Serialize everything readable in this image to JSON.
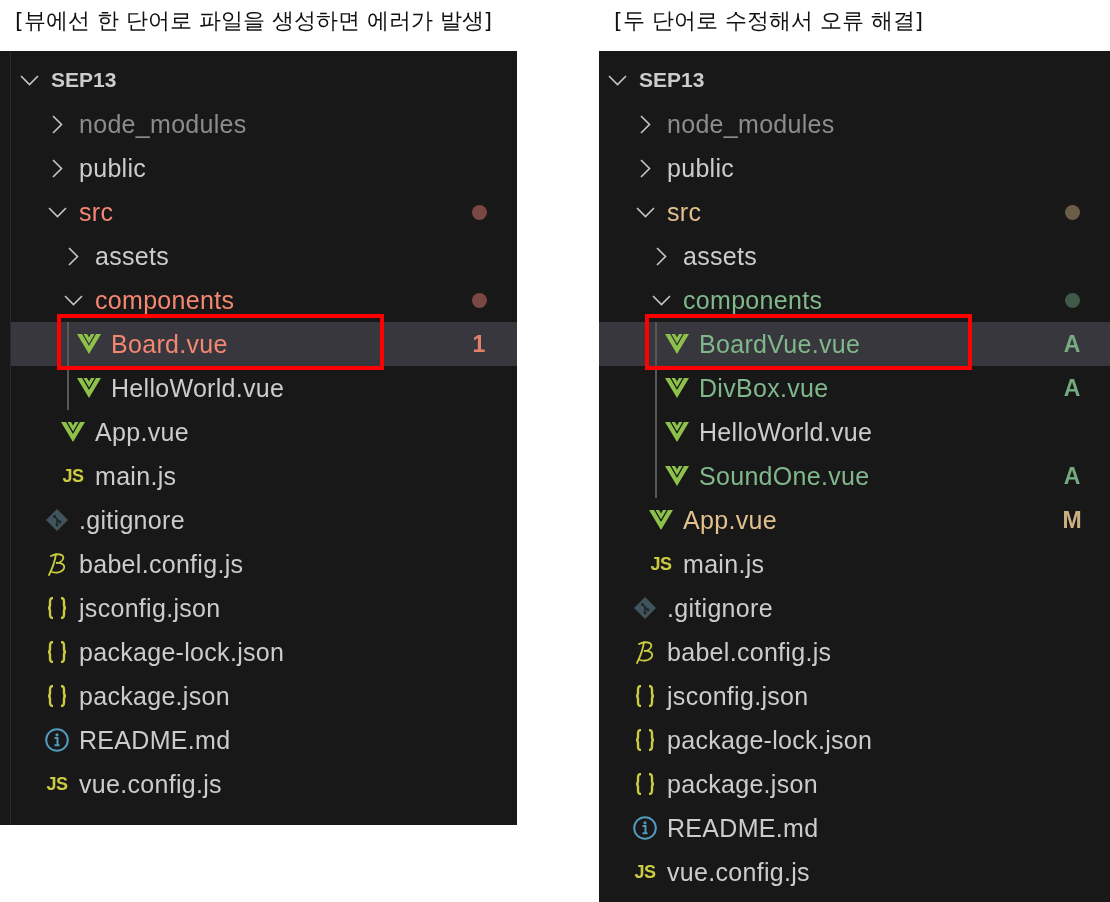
{
  "panels": [
    {
      "caption": "[뷰에선 한 단어로 파일을 생성하면 에러가 발생]",
      "edge_line": true,
      "tree": {
        "name": "SEP13",
        "kind": "folder",
        "expanded": true,
        "selected": false,
        "highlighted": false,
        "color": "#cccccc",
        "indent_guide": false,
        "children": [
          {
            "name": "node_modules",
            "kind": "folder",
            "expanded": false,
            "selected": false,
            "highlighted": false,
            "color": "#8c8c8c"
          },
          {
            "name": "public",
            "kind": "folder",
            "expanded": false,
            "selected": false,
            "highlighted": false,
            "color": "#cccccc"
          },
          {
            "name": "src",
            "kind": "folder",
            "expanded": true,
            "selected": false,
            "highlighted": false,
            "color": "#f48771",
            "dot": {
              "color": "#7a4842"
            },
            "indent_guide": false,
            "children": [
              {
                "name": "assets",
                "kind": "folder",
                "expanded": false,
                "selected": false,
                "highlighted": false,
                "color": "#cccccc"
              },
              {
                "name": "components",
                "kind": "folder",
                "expanded": true,
                "selected": false,
                "highlighted": false,
                "color": "#f48771",
                "dot": {
                  "color": "#7a4842"
                },
                "indent_guide": true,
                "children": [
                  {
                    "name": "Board.vue",
                    "kind": "vue",
                    "selected": true,
                    "highlighted": true,
                    "color": "#f48771",
                    "badge": "1"
                  },
                  {
                    "name": "HelloWorld.vue",
                    "kind": "vue",
                    "selected": false,
                    "highlighted": false,
                    "color": "#cccccc"
                  }
                ]
              },
              {
                "name": "App.vue",
                "kind": "vue",
                "selected": false,
                "highlighted": false,
                "color": "#cccccc"
              },
              {
                "name": "main.js",
                "kind": "js",
                "icon_label": "JS",
                "selected": false,
                "highlighted": false,
                "color": "#cccccc"
              }
            ]
          },
          {
            "name": ".gitignore",
            "kind": "git",
            "selected": false,
            "highlighted": false,
            "color": "#cccccc"
          },
          {
            "name": "babel.config.js",
            "kind": "babel",
            "selected": false,
            "highlighted": false,
            "color": "#cccccc"
          },
          {
            "name": "jsconfig.json",
            "kind": "json",
            "selected": false,
            "highlighted": false,
            "color": "#cccccc"
          },
          {
            "name": "package-lock.json",
            "kind": "json",
            "selected": false,
            "highlighted": false,
            "color": "#cccccc"
          },
          {
            "name": "package.json",
            "kind": "json",
            "selected": false,
            "highlighted": false,
            "color": "#cccccc"
          },
          {
            "name": "README.md",
            "kind": "info",
            "selected": false,
            "highlighted": false,
            "color": "#cccccc"
          },
          {
            "name": "vue.config.js",
            "kind": "js",
            "icon_label": "JS",
            "selected": false,
            "highlighted": false,
            "color": "#cccccc"
          }
        ]
      }
    },
    {
      "caption": "[두 단어로 수정해서 오류 해결]",
      "edge_line": false,
      "tree": {
        "name": "SEP13",
        "kind": "folder",
        "expanded": true,
        "selected": false,
        "highlighted": false,
        "color": "#cccccc",
        "indent_guide": false,
        "children": [
          {
            "name": "node_modules",
            "kind": "folder",
            "expanded": false,
            "selected": false,
            "highlighted": false,
            "color": "#8c8c8c"
          },
          {
            "name": "public",
            "kind": "folder",
            "expanded": false,
            "selected": false,
            "highlighted": false,
            "color": "#cccccc"
          },
          {
            "name": "src",
            "kind": "folder",
            "expanded": true,
            "selected": false,
            "highlighted": false,
            "color": "#e2c08d",
            "dot": {
              "color": "#6b5d47"
            },
            "indent_guide": false,
            "children": [
              {
                "name": "assets",
                "kind": "folder",
                "expanded": false,
                "selected": false,
                "highlighted": false,
                "color": "#cccccc"
              },
              {
                "name": "components",
                "kind": "folder",
                "expanded": true,
                "selected": false,
                "highlighted": false,
                "color": "#81b88b",
                "dot": {
                  "color": "#3f5a47"
                },
                "indent_guide": true,
                "children": [
                  {
                    "name": "BoardVue.vue",
                    "kind": "vue",
                    "selected": true,
                    "highlighted": true,
                    "color": "#81b88b",
                    "badge": "A"
                  },
                  {
                    "name": "DivBox.vue",
                    "kind": "vue",
                    "selected": false,
                    "highlighted": false,
                    "color": "#81b88b",
                    "badge": "A"
                  },
                  {
                    "name": "HelloWorld.vue",
                    "kind": "vue",
                    "selected": false,
                    "highlighted": false,
                    "color": "#cccccc"
                  },
                  {
                    "name": "SoundOne.vue",
                    "kind": "vue",
                    "selected": false,
                    "highlighted": false,
                    "color": "#81b88b",
                    "badge": "A"
                  }
                ]
              },
              {
                "name": "App.vue",
                "kind": "vue",
                "selected": false,
                "highlighted": false,
                "color": "#e2c08d",
                "badge": "M"
              },
              {
                "name": "main.js",
                "kind": "js",
                "icon_label": "JS",
                "selected": false,
                "highlighted": false,
                "color": "#cccccc"
              }
            ]
          },
          {
            "name": ".gitignore",
            "kind": "git",
            "selected": false,
            "highlighted": false,
            "color": "#cccccc"
          },
          {
            "name": "babel.config.js",
            "kind": "babel",
            "selected": false,
            "highlighted": false,
            "color": "#cccccc"
          },
          {
            "name": "jsconfig.json",
            "kind": "json",
            "selected": false,
            "highlighted": false,
            "color": "#cccccc"
          },
          {
            "name": "package-lock.json",
            "kind": "json",
            "selected": false,
            "highlighted": false,
            "color": "#cccccc"
          },
          {
            "name": "package.json",
            "kind": "json",
            "selected": false,
            "highlighted": false,
            "color": "#cccccc"
          },
          {
            "name": "README.md",
            "kind": "info",
            "selected": false,
            "highlighted": false,
            "color": "#cccccc"
          },
          {
            "name": "vue.config.js",
            "kind": "js",
            "icon_label": "JS",
            "selected": false,
            "highlighted": false,
            "color": "#cccccc"
          }
        ]
      }
    }
  ]
}
